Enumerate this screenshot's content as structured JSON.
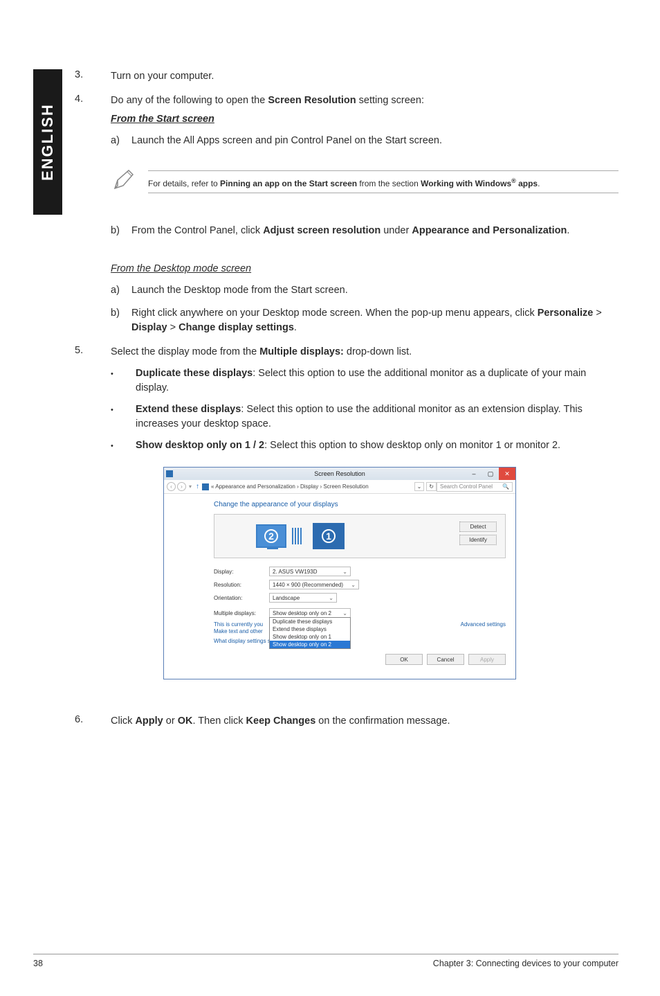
{
  "sidebar": {
    "language": "ENGLISH"
  },
  "steps": {
    "s3": {
      "num": "3.",
      "text": "Turn on your computer."
    },
    "s4": {
      "num": "4.",
      "intro_a": "Do any of the following to open the ",
      "intro_b": "Screen Resolution",
      "intro_c": " setting screen:",
      "heading1": "From the Start screen",
      "a_a": "a)",
      "a_text": "Launch the All Apps screen and pin Control Panel on the Start screen.",
      "b_a": "b)",
      "b_text_a": "From the Control Panel, click ",
      "b_text_b": "Adjust screen resolution",
      "b_text_c": " under ",
      "b_text_d": "Appearance and Personalization",
      "b_text_e": ".",
      "heading2": "From the Desktop mode screen",
      "c_a": "a)",
      "c_text": "Launch the Desktop mode from the Start screen.",
      "d_a": "b)",
      "d_text_a": "Right click anywhere on your Desktop mode screen. When the pop-up menu appears, click ",
      "d_text_b": "Personalize",
      "d_text_c": " > ",
      "d_text_d": "Display",
      "d_text_e": " > ",
      "d_text_f": "Change display settings",
      "d_text_g": "."
    },
    "s5": {
      "num": "5.",
      "intro_a": "Select the display mode from the ",
      "intro_b": "Multiple displays:",
      "intro_c": " drop-down list.",
      "bullets": [
        {
          "b": "Duplicate these displays",
          "rest": ": Select this option to use the additional monitor as a duplicate of your main display."
        },
        {
          "b": "Extend these displays",
          "rest": ": Select this option to use the additional monitor as an extension display. This increases your desktop space."
        },
        {
          "b": "Show desktop only on 1 / 2",
          "rest": ": Select this option to show desktop only on monitor 1 or monitor 2."
        }
      ]
    },
    "s6": {
      "num": "6.",
      "a": "Click ",
      "b": "Apply",
      "c": " or ",
      "d": "OK",
      "e": ". Then click ",
      "f": "Keep Changes",
      "g": " on the confirmation message."
    }
  },
  "note": {
    "a": "For details, refer to ",
    "b": "Pinning an app on the Start screen",
    "c": " from the section ",
    "d": "Working with Windows",
    "sup": "®",
    "e": " apps",
    "f": "."
  },
  "screenshot": {
    "title": "Screen Resolution",
    "breadcrumb": " « Appearance and Personalization › Display › Screen Resolution",
    "search_placeholder": "Search Control Panel",
    "heading": "Change the appearance of your displays",
    "detect": "Detect",
    "identify": "Identify",
    "mon2": "2",
    "mon1": "1",
    "fields": {
      "display_label": "Display:",
      "display_value": "2. ASUS VW193D",
      "resolution_label": "Resolution:",
      "resolution_value": "1440 × 900 (Recommended)",
      "orientation_label": "Orientation:",
      "orientation_value": "Landscape",
      "multi_label": "Multiple displays:",
      "multi_value": "Show desktop only on 2"
    },
    "dropdown": [
      "Duplicate these displays",
      "Extend these displays",
      "Show desktop only on 1",
      "Show desktop only on 2"
    ],
    "main_display_a": "This is currently you",
    "make_text": "Make text and other",
    "advanced": "Advanced settings",
    "what_display": "What display settings should I choose?",
    "ok": "OK",
    "cancel": "Cancel",
    "apply": "Apply"
  },
  "footer": {
    "page": "38",
    "chapter": "Chapter 3: Connecting devices to your computer"
  }
}
